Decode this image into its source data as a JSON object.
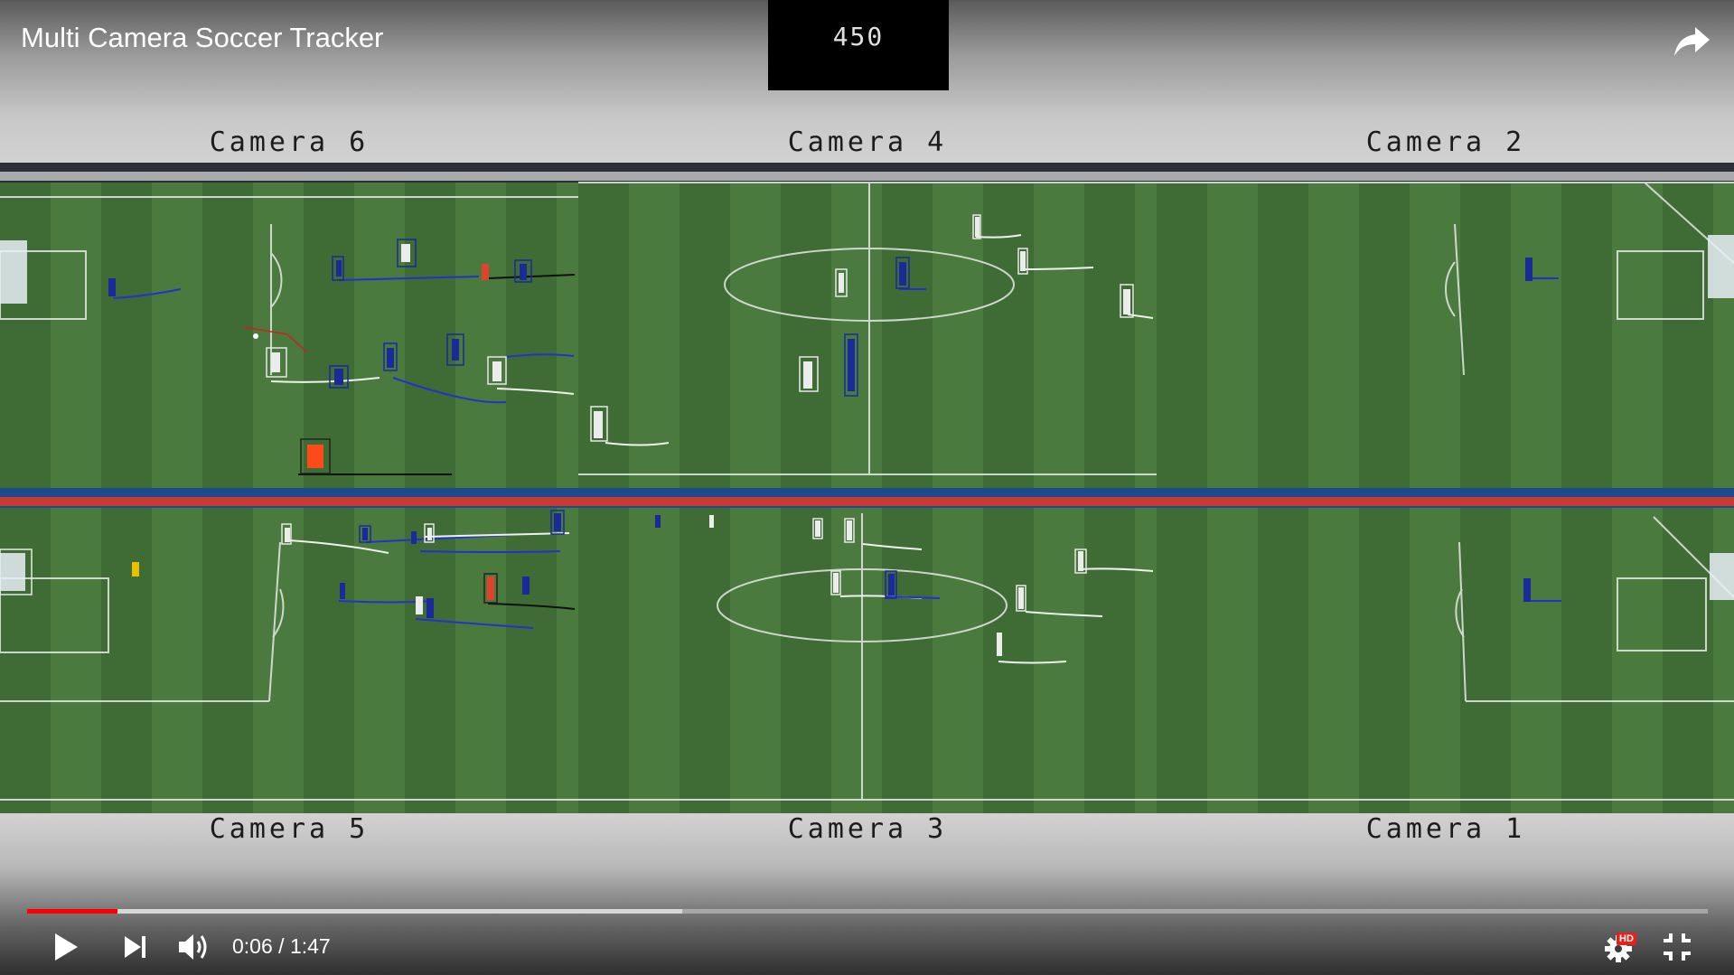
{
  "player": {
    "title": "Multi Camera Soccer Tracker",
    "frame_number": "450",
    "time_current": "0:06",
    "time_separator": " / ",
    "time_total": "1:47",
    "progress_played": 0.054,
    "progress_buffered": 0.39,
    "hd_badge": "HD",
    "accent_color": "#ff0000"
  },
  "cameras": {
    "top": [
      "Camera 6",
      "Camera 4",
      "Camera 2"
    ],
    "bottom": [
      "Camera 5",
      "Camera 3",
      "Camera 1"
    ]
  },
  "icons": {
    "share": "share-icon",
    "play": "play-icon",
    "next": "next-icon",
    "volume": "volume-icon",
    "settings": "settings-icon",
    "fullscreen_exit": "exit-fullscreen-icon"
  }
}
